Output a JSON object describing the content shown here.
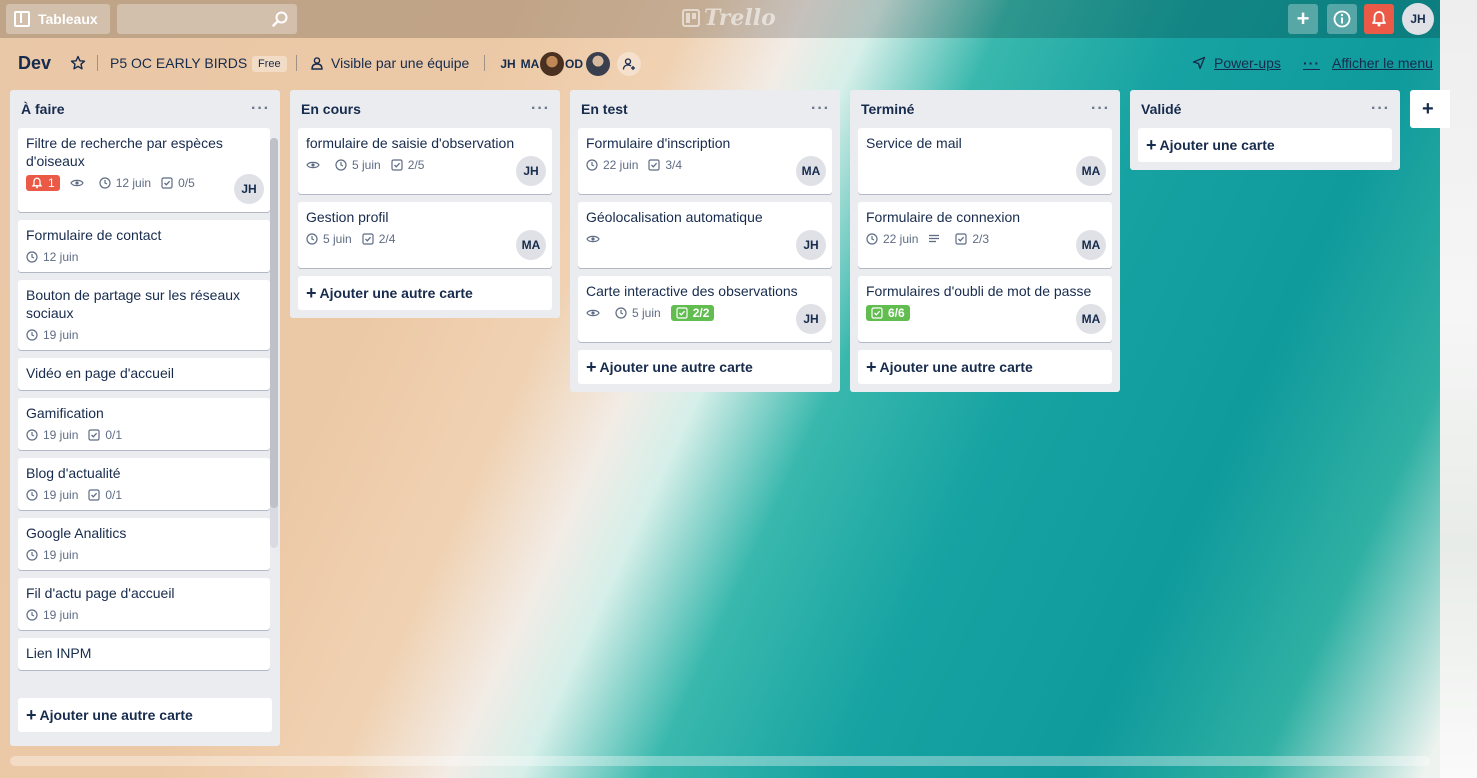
{
  "topbar": {
    "boards_label": "Tableaux",
    "search": {
      "value": "",
      "placeholder": ""
    },
    "logo": "Trello",
    "user_initials": "JH"
  },
  "board": {
    "title": "Dev",
    "team": "P5 OC EARLY BIRDS",
    "plan": "Free",
    "visibility": "Visible par une équipe",
    "members": [
      "JH",
      "MA",
      "OD"
    ],
    "powerups": "Power-ups",
    "menu": "Afficher le menu"
  },
  "lists": [
    {
      "title": "À faire",
      "add_label": "Ajouter une autre carte",
      "cards": [
        {
          "title": "Filtre de recherche par espèces d'oiseaux",
          "notif": "1",
          "watch": true,
          "due": "12 juin",
          "checklist": "0/5",
          "member": "JH"
        },
        {
          "title": "Formulaire de contact",
          "due": "12 juin"
        },
        {
          "title": "Bouton de partage sur les réseaux sociaux",
          "due": "19 juin"
        },
        {
          "title": "Vidéo en page d'accueil"
        },
        {
          "title": "Gamification",
          "due": "19 juin",
          "checklist": "0/1"
        },
        {
          "title": "Blog d'actualité",
          "due": "19 juin",
          "checklist": "0/1"
        },
        {
          "title": "Google Analitics",
          "due": "19 juin"
        },
        {
          "title": "Fil d'actu page d'accueil",
          "due": "19 juin"
        },
        {
          "title": "Lien INPM"
        }
      ]
    },
    {
      "title": "En cours",
      "add_label": "Ajouter une autre carte",
      "cards": [
        {
          "title": "formulaire de saisie d'observation",
          "watch": true,
          "due": "5 juin",
          "checklist": "2/5",
          "member": "JH"
        },
        {
          "title": "Gestion profil",
          "due": "5 juin",
          "checklist": "2/4",
          "member": "MA"
        }
      ]
    },
    {
      "title": "En test",
      "add_label": "Ajouter une autre carte",
      "cards": [
        {
          "title": "Formulaire d'inscription",
          "due": "22 juin",
          "checklist": "3/4",
          "member": "MA"
        },
        {
          "title": "Géolocalisation automatique",
          "watch": true,
          "member": "JH"
        },
        {
          "title": "Carte interactive des observations",
          "watch": true,
          "due": "5 juin",
          "checklist_done": "2/2",
          "member": "JH"
        }
      ]
    },
    {
      "title": "Terminé",
      "add_label": "Ajouter une autre carte",
      "cards": [
        {
          "title": "Service de mail",
          "member": "MA"
        },
        {
          "title": "Formulaire de connexion",
          "due": "22 juin",
          "description": true,
          "checklist": "2/3",
          "member": "MA"
        },
        {
          "title": "Formulaires d'oubli de mot de passe",
          "checklist_done": "6/6",
          "member": "MA"
        }
      ]
    },
    {
      "title": "Validé",
      "add_label": "Ajouter une carte",
      "cards": []
    }
  ],
  "colors": {
    "notification_red": "#eb5a46",
    "checklist_done_green": "#61bd4f",
    "list_bg": "#ebecf0"
  },
  "icons": [
    "board-icon",
    "search-icon",
    "plus-icon",
    "info-icon",
    "bell-icon",
    "star-icon",
    "team-icon",
    "add-member-icon",
    "powerups-icon",
    "eye-icon",
    "clock-icon",
    "checklist-icon",
    "description-icon"
  ]
}
